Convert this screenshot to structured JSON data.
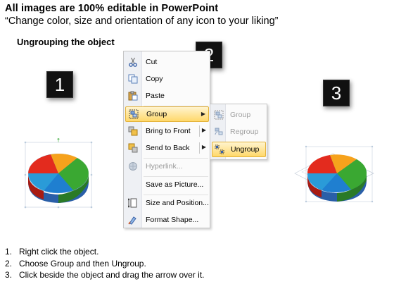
{
  "header": {
    "title": "All images are 100% editable in PowerPoint",
    "subtitle": "“Change color, size and orientation of any icon to your liking”"
  },
  "section_title": "Ungrouping the object",
  "badges": [
    "1",
    "2",
    "3"
  ],
  "context_menu": {
    "items": [
      {
        "label": "Cut",
        "icon": "scissors-icon",
        "enabled": true,
        "submenu": false
      },
      {
        "label": "Copy",
        "icon": "copy-icon",
        "enabled": true,
        "submenu": false
      },
      {
        "label": "Paste",
        "icon": "paste-icon",
        "enabled": true,
        "submenu": false
      },
      {
        "label": "Group",
        "icon": "group-icon",
        "enabled": true,
        "submenu": true,
        "highlighted": true
      },
      {
        "label": "Bring to Front",
        "icon": "bring-to-front-icon",
        "enabled": true,
        "submenu": true
      },
      {
        "label": "Send to Back",
        "icon": "send-to-back-icon",
        "enabled": true,
        "submenu": true
      },
      {
        "label": "Hyperlink...",
        "icon": "hyperlink-icon",
        "enabled": false,
        "submenu": false
      },
      {
        "label": "Save as Picture...",
        "icon": "",
        "enabled": true,
        "submenu": false
      },
      {
        "label": "Size and Position...",
        "icon": "size-position-icon",
        "enabled": true,
        "submenu": false
      },
      {
        "label": "Format Shape...",
        "icon": "format-shape-icon",
        "enabled": true,
        "submenu": false
      }
    ]
  },
  "submenu": {
    "items": [
      {
        "label": "Group",
        "icon": "group-icon",
        "enabled": false
      },
      {
        "label": "Regroup",
        "icon": "regroup-icon",
        "enabled": false
      },
      {
        "label": "Ungroup",
        "icon": "ungroup-icon",
        "enabled": true,
        "highlighted": true
      }
    ]
  },
  "instructions": [
    "Right click the object.",
    "Choose Group and then Ungroup.",
    "Click beside the object and drag the arrow over it."
  ],
  "colors": {
    "highlight_top": "#fff4cf",
    "highlight_bottom": "#ffd86a",
    "pie_red": "#e32b1e",
    "pie_orange": "#f6a21c",
    "pie_green": "#3aa832",
    "pie_blue": "#1f7fd0"
  }
}
